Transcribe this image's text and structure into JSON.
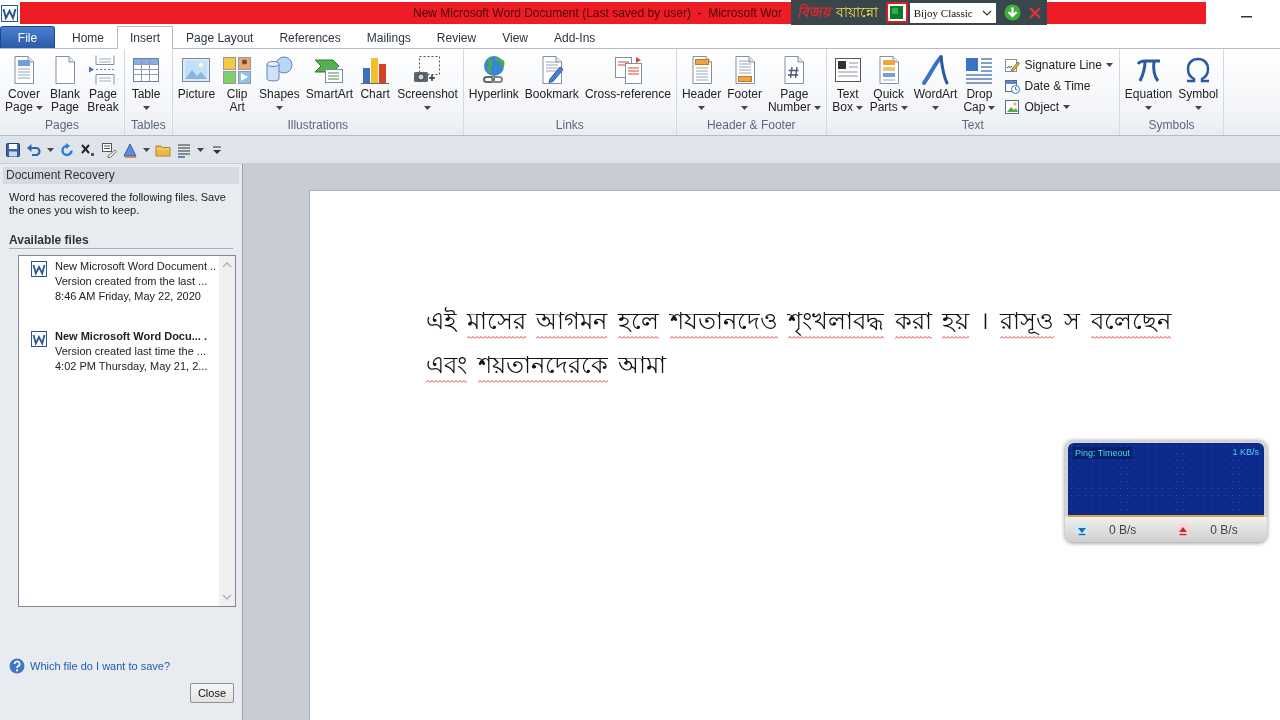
{
  "title_bar": {
    "title": "New Microsoft Word Document (Last saved by user)  -  Microsoft Wor"
  },
  "keyboard_toolbar": {
    "logo": "বিজয়",
    "product": "বায়ান্নো",
    "layout": "Bijoy Classic"
  },
  "tabs": [
    {
      "label": "File",
      "kind": "backstage",
      "selected": false
    },
    {
      "label": "Home",
      "kind": "tab",
      "selected": false
    },
    {
      "label": "Insert",
      "kind": "tab",
      "selected": true
    },
    {
      "label": "Page Layout",
      "kind": "tab",
      "selected": false
    },
    {
      "label": "References",
      "kind": "tab",
      "selected": false
    },
    {
      "label": "Mailings",
      "kind": "tab",
      "selected": false
    },
    {
      "label": "Review",
      "kind": "tab",
      "selected": false
    },
    {
      "label": "View",
      "kind": "tab",
      "selected": false
    },
    {
      "label": "Add-Ins",
      "kind": "tab",
      "selected": false
    }
  ],
  "ribbon": {
    "groups": [
      {
        "label": "Pages",
        "buttons": [
          {
            "lines": [
              "Cover",
              "Page"
            ],
            "menu": true
          },
          {
            "lines": [
              "Blank",
              "Page"
            ],
            "menu": false
          },
          {
            "lines": [
              "Page",
              "Break"
            ],
            "menu": false
          }
        ]
      },
      {
        "label": "Tables",
        "buttons": [
          {
            "lines": [
              "Table"
            ],
            "menu": true
          }
        ]
      },
      {
        "label": "Illustrations",
        "buttons": [
          {
            "lines": [
              "Picture"
            ],
            "menu": false
          },
          {
            "lines": [
              "Clip",
              "Art"
            ],
            "menu": false
          },
          {
            "lines": [
              "Shapes"
            ],
            "menu": true
          },
          {
            "lines": [
              "SmartArt"
            ],
            "menu": false
          },
          {
            "lines": [
              "Chart"
            ],
            "menu": false
          },
          {
            "lines": [
              "Screenshot"
            ],
            "menu": true
          }
        ]
      },
      {
        "label": "Links",
        "buttons": [
          {
            "lines": [
              "Hyperlink"
            ],
            "menu": false
          },
          {
            "lines": [
              "Bookmark"
            ],
            "menu": false
          },
          {
            "lines": [
              "Cross-reference"
            ],
            "menu": false
          }
        ]
      },
      {
        "label": "Header & Footer",
        "buttons": [
          {
            "lines": [
              "Header"
            ],
            "menu": true
          },
          {
            "lines": [
              "Footer"
            ],
            "menu": true
          },
          {
            "lines": [
              "Page",
              "Number"
            ],
            "menu": true
          }
        ]
      },
      {
        "label": "Text",
        "buttons": [
          {
            "lines": [
              "Text",
              "Box"
            ],
            "menu": true
          },
          {
            "lines": [
              "Quick",
              "Parts"
            ],
            "menu": true
          },
          {
            "lines": [
              "WordArt"
            ],
            "menu": true
          },
          {
            "lines": [
              "Drop",
              "Cap"
            ],
            "menu": true
          }
        ],
        "small_buttons": [
          {
            "label": "Signature Line",
            "menu": true
          },
          {
            "label": "Date & Time",
            "menu": false
          },
          {
            "label": "Object",
            "menu": true
          }
        ]
      },
      {
        "label": "Symbols",
        "buttons": [
          {
            "lines": [
              "Equation"
            ],
            "menu": true
          },
          {
            "lines": [
              "Symbol"
            ],
            "menu": true
          }
        ]
      }
    ]
  },
  "recovery_pane": {
    "title": "Document Recovery",
    "message": "Word has recovered the following files.  Save the ones you wish to keep.",
    "section": "Available files",
    "files": [
      {
        "name": "New Microsoft Word Document ..",
        "detail": "Version created from the last ...",
        "time": "8:46 AM Friday, May 22, 2020",
        "bold": false
      },
      {
        "name": "New Microsoft Word Docu... .",
        "detail": "Version created last time the ...",
        "time": "4:02 PM Thursday, May 21, 2...",
        "bold": true
      }
    ],
    "help_link": "Which file do I want to save?",
    "close_button": "Close"
  },
  "document": {
    "lines": [
      {
        "words": [
          {
            "text": "এই",
            "misspelled": false
          },
          {
            "text": "মাসের",
            "misspelled": true
          },
          {
            "text": "আগমন",
            "misspelled": true
          },
          {
            "text": "হলে",
            "misspelled": true
          },
          {
            "text": "শযতানদেও",
            "misspelled": true
          },
          {
            "text": "শৃংখলাবদ্ধ",
            "misspelled": true
          },
          {
            "text": "করা",
            "misspelled": true
          },
          {
            "text": "হয়",
            "misspelled": true
          },
          {
            "text": "।",
            "misspelled": false
          },
          {
            "text": "রাসূও",
            "misspelled": true
          },
          {
            "text": "স",
            "misspelled": false
          },
          {
            "text": "বলেছেন",
            "misspelled": true
          }
        ]
      },
      {
        "words": [
          {
            "text": "এবং",
            "misspelled": true
          },
          {
            "text": "শয়তানদেরকে",
            "misspelled": true
          },
          {
            "text": "আমা",
            "misspelled": false
          }
        ]
      }
    ]
  },
  "network_meter": {
    "ping": "Ping: Timeout",
    "scale": "1 KB/s",
    "download": "0 B/s",
    "upload": "0 B/s"
  }
}
